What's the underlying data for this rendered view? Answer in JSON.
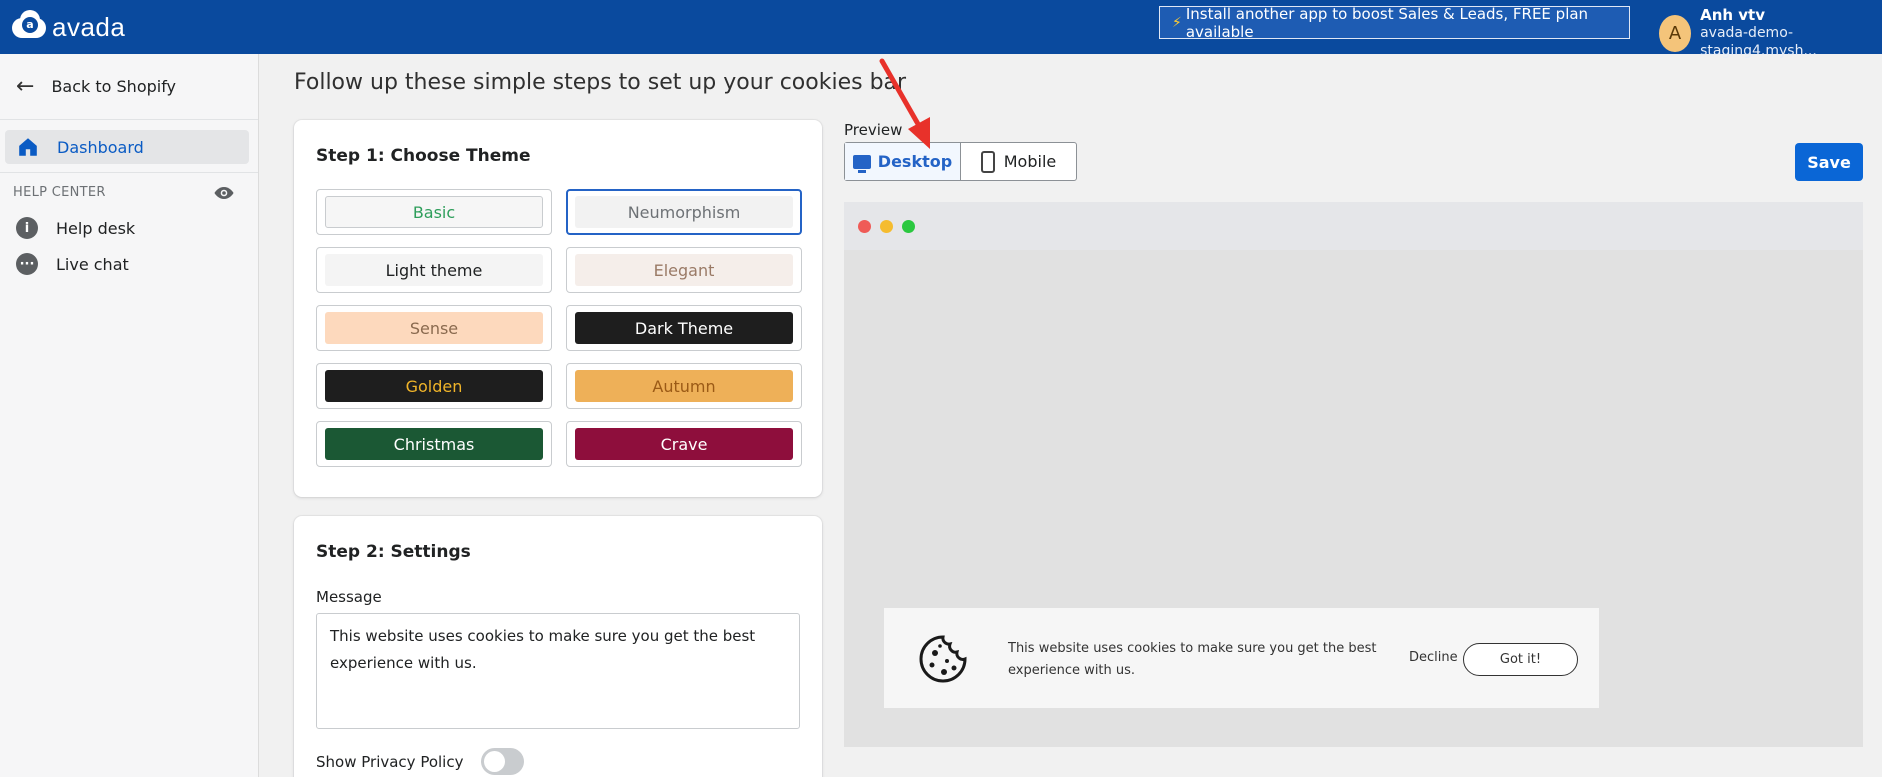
{
  "topbar": {
    "brand": "avada",
    "logo_letter": "a",
    "promo_icon": "lightning-bolt-icon",
    "promo": "Install another app to boost Sales & Leads, FREE plan available",
    "user": {
      "initial": "A",
      "name": "Anh vtv",
      "store": "avada-demo-staging4.mysh..."
    }
  },
  "sidebar": {
    "back": "Back to Shopify",
    "dashboard": "Dashboard",
    "help_center": "HELP CENTER",
    "items": [
      {
        "label": "Help desk",
        "icon": "info-icon"
      },
      {
        "label": "Live chat",
        "icon": "chat-icon"
      }
    ]
  },
  "main": {
    "heading": "Follow up these simple steps to set up your cookies bar",
    "step1": {
      "title": "Step 1: Choose Theme",
      "themes": [
        {
          "label": "Basic",
          "bg": "#f6f6f6",
          "fg": "#2e9e5b",
          "border": "#c9cccf",
          "selected": false
        },
        {
          "label": "Neumorphism",
          "bg": "#f2f2f2",
          "fg": "#6d7175",
          "selected": true
        },
        {
          "label": "Light theme",
          "bg": "#f4f4f4",
          "fg": "#202223",
          "selected": false
        },
        {
          "label": "Elegant",
          "bg": "#f5eeea",
          "fg": "#9a7a66",
          "selected": false
        },
        {
          "label": "Sense",
          "bg": "#fdd9bd",
          "fg": "#8a6a4f",
          "selected": false
        },
        {
          "label": "Dark Theme",
          "bg": "#1e1e1e",
          "fg": "#ffffff",
          "selected": false
        },
        {
          "label": "Golden",
          "bg": "#1e1e1e",
          "fg": "#f0b429",
          "selected": false
        },
        {
          "label": "Autumn",
          "bg": "#eeb058",
          "fg": "#9b5a16",
          "selected": false
        },
        {
          "label": "Christmas",
          "bg": "#1b5834",
          "fg": "#ffffff",
          "selected": false
        },
        {
          "label": "Crave",
          "bg": "#8e0e3c",
          "fg": "#ffffff",
          "selected": false
        }
      ]
    },
    "step2": {
      "title": "Step 2: Settings",
      "message_label": "Message",
      "message": "This website uses cookies to make sure you get the best experience with us.",
      "privacy_label": "Show Privacy Policy",
      "privacy_enabled": false
    }
  },
  "preview": {
    "label": "Preview",
    "desktop": "Desktop",
    "mobile": "Mobile",
    "active": "Desktop",
    "save": "Save",
    "window_dots": [
      "#ef5b57",
      "#f5bc2f",
      "#2bc840"
    ],
    "cookie_icon": "cookie-icon",
    "cookie_message": "This website uses cookies to make sure you get the best experience with us.",
    "decline": "Decline",
    "accept": "Got it!"
  },
  "colors": {
    "topbar": "#0a4a9e",
    "accent": "#2463c6",
    "save": "#0a66d6",
    "annotation": "#e8312a"
  }
}
